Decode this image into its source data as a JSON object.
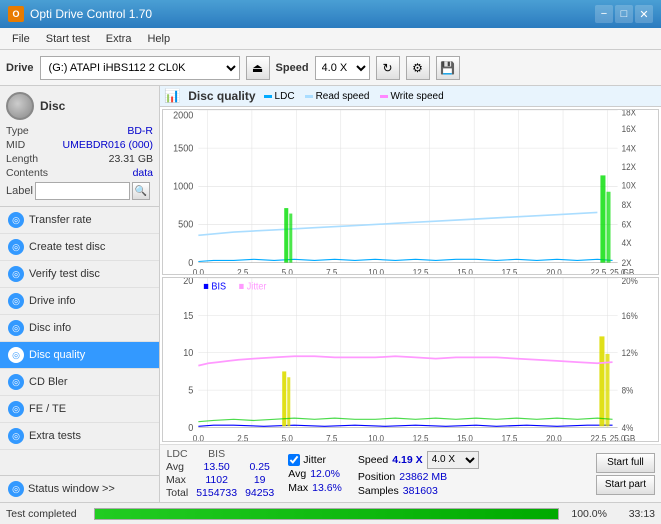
{
  "app": {
    "title": "Opti Drive Control 1.70",
    "icon": "ODC"
  },
  "titlebar": {
    "title": "Opti Drive Control 1.70",
    "minimize": "−",
    "maximize": "□",
    "close": "✕"
  },
  "menubar": {
    "items": [
      "File",
      "Start test",
      "Extra",
      "Help"
    ]
  },
  "toolbar": {
    "drive_label": "Drive",
    "drive_value": "(G:) ATAPI iHBS112  2 CL0K",
    "speed_label": "Speed",
    "speed_value": "4.0 X"
  },
  "disc": {
    "type_label": "Type",
    "type_value": "BD-R",
    "mid_label": "MID",
    "mid_value": "UMEBDR016 (000)",
    "length_label": "Length",
    "length_value": "23.31 GB",
    "contents_label": "Contents",
    "contents_value": "data",
    "label_label": "Label",
    "label_placeholder": ""
  },
  "nav": {
    "items": [
      {
        "id": "transfer-rate",
        "label": "Transfer rate",
        "active": false
      },
      {
        "id": "create-test-disc",
        "label": "Create test disc",
        "active": false
      },
      {
        "id": "verify-test-disc",
        "label": "Verify test disc",
        "active": false
      },
      {
        "id": "drive-info",
        "label": "Drive info",
        "active": false
      },
      {
        "id": "disc-info",
        "label": "Disc info",
        "active": false
      },
      {
        "id": "disc-quality",
        "label": "Disc quality",
        "active": true
      },
      {
        "id": "cd-bler",
        "label": "CD Bler",
        "active": false
      },
      {
        "id": "fe-te",
        "label": "FE / TE",
        "active": false
      },
      {
        "id": "extra-tests",
        "label": "Extra tests",
        "active": false
      }
    ],
    "status_window": "Status window >>"
  },
  "chart": {
    "title": "Disc quality",
    "legend": {
      "ldc": "LDC",
      "read_speed": "Read speed",
      "write_speed": "Write speed",
      "bis": "BIS",
      "jitter": "Jitter"
    },
    "top": {
      "y_max": 2000,
      "y_labels": [
        "2000",
        "1500",
        "1000",
        "500",
        "0"
      ],
      "y_right_labels": [
        "18X",
        "16X",
        "14X",
        "12X",
        "10X",
        "8X",
        "6X",
        "4X",
        "2X"
      ],
      "x_labels": [
        "0.0",
        "2.5",
        "5.0",
        "7.5",
        "10.0",
        "12.5",
        "15.0",
        "17.5",
        "20.0",
        "22.5",
        "25.0"
      ],
      "x_unit": "GB"
    },
    "bottom": {
      "y_max": 20,
      "y_labels": [
        "20",
        "15",
        "10",
        "5"
      ],
      "y_right_labels": [
        "20%",
        "16%",
        "12%",
        "8%",
        "4%"
      ],
      "x_labels": [
        "0.0",
        "2.5",
        "5.0",
        "7.5",
        "10.0",
        "12.5",
        "15.0",
        "17.5",
        "20.0",
        "22.5",
        "25.0"
      ],
      "x_unit": "GB"
    }
  },
  "stats": {
    "ldc_label": "LDC",
    "bis_label": "BIS",
    "jitter_label": "Jitter",
    "avg_label": "Avg",
    "max_label": "Max",
    "total_label": "Total",
    "ldc_avg": "13.50",
    "ldc_max": "1102",
    "ldc_total": "5154733",
    "bis_avg": "0.25",
    "bis_max": "19",
    "bis_total": "94253",
    "jitter_checked": true,
    "jitter_avg": "12.0%",
    "jitter_max": "13.6%",
    "speed_label": "Speed",
    "speed_value": "4.19 X",
    "speed_select": "4.0 X",
    "position_label": "Position",
    "position_value": "23862 MB",
    "samples_label": "Samples",
    "samples_value": "381603",
    "start_full": "Start full",
    "start_part": "Start part"
  },
  "bottom": {
    "status": "Test completed",
    "progress": 100,
    "progress_pct": "100.0%",
    "time": "33:13"
  },
  "colors": {
    "ldc": "#00aaff",
    "bis": "#0000ff",
    "jitter": "#ff99ff",
    "read_speed": "#aaddff",
    "write_speed": "#ffaaaa",
    "spike_green": "#00dd00",
    "spike_yellow": "#dddd00",
    "accent": "#3399ff",
    "active_nav": "#3399ff"
  }
}
